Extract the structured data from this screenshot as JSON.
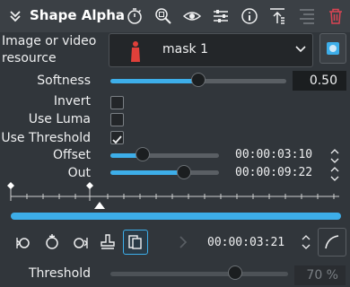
{
  "header": {
    "title": "Shape Alpha",
    "icons": [
      "chevron-down-icon",
      "stopwatch-icon",
      "zoom-icon",
      "eye-icon",
      "sliders-icon",
      "info-icon",
      "sort-icon",
      "align-icon",
      "trash-icon"
    ]
  },
  "resource": {
    "label": "Image or video resource",
    "label_line1": "Image or video",
    "label_line2": "resource",
    "selected": "mask 1",
    "swatch_color": "#e0403a"
  },
  "softness": {
    "label": "Softness",
    "value": "0.50",
    "level": 0.5
  },
  "invert": {
    "label": "Invert",
    "checked": false
  },
  "use_luma": {
    "label": "Use Luma",
    "checked": false
  },
  "use_threshold": {
    "label": "Use Threshold",
    "checked": true
  },
  "offset": {
    "label": "Offset",
    "timecode": "00:00:03:10"
  },
  "out": {
    "label": "Out",
    "timecode": "00:00:09:22"
  },
  "keyframes": {
    "current_timecode": "00:00:03:21"
  },
  "threshold": {
    "label": "Threshold",
    "value": "70 %",
    "level": 0.7
  },
  "colors": {
    "accent": "#3daee9",
    "background": "#31363b",
    "delete": "#da4453"
  }
}
